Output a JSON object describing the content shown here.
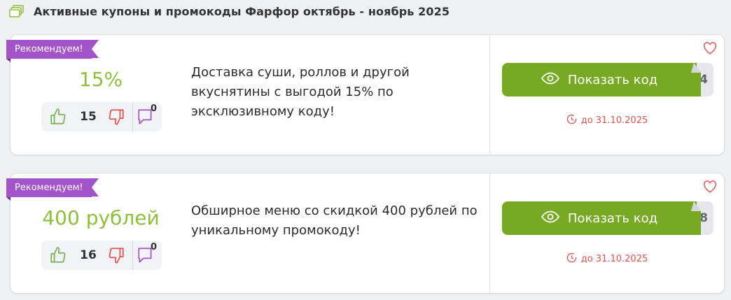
{
  "heading": {
    "icon": "copy-icon",
    "title": "Активные купоны и промокоды Фарфор октябрь - ноябрь 2025"
  },
  "colors": {
    "accent_green": "#77a925",
    "value_green": "#8fbf3f",
    "ribbon_purple": "#a454c9",
    "expiry_red": "#d9534f"
  },
  "coupons": [
    {
      "badge": "Рекомендуем!",
      "value": "15%",
      "likes": "15",
      "comments": "0",
      "description": "Доставка суши, роллов и другой вкуснятины с выгодой 15% по эксклюзивному коду!",
      "button_label": "Показать код",
      "code_hint": "4",
      "expiry": "до 31.10.2025"
    },
    {
      "badge": "Рекомендуем!",
      "value": "400 рублей",
      "likes": "16",
      "comments": "0",
      "description": "Обширное меню со скидкой 400 рублей по уникальному промокоду!",
      "button_label": "Показать код",
      "code_hint": "8",
      "expiry": "до 31.10.2025"
    }
  ]
}
